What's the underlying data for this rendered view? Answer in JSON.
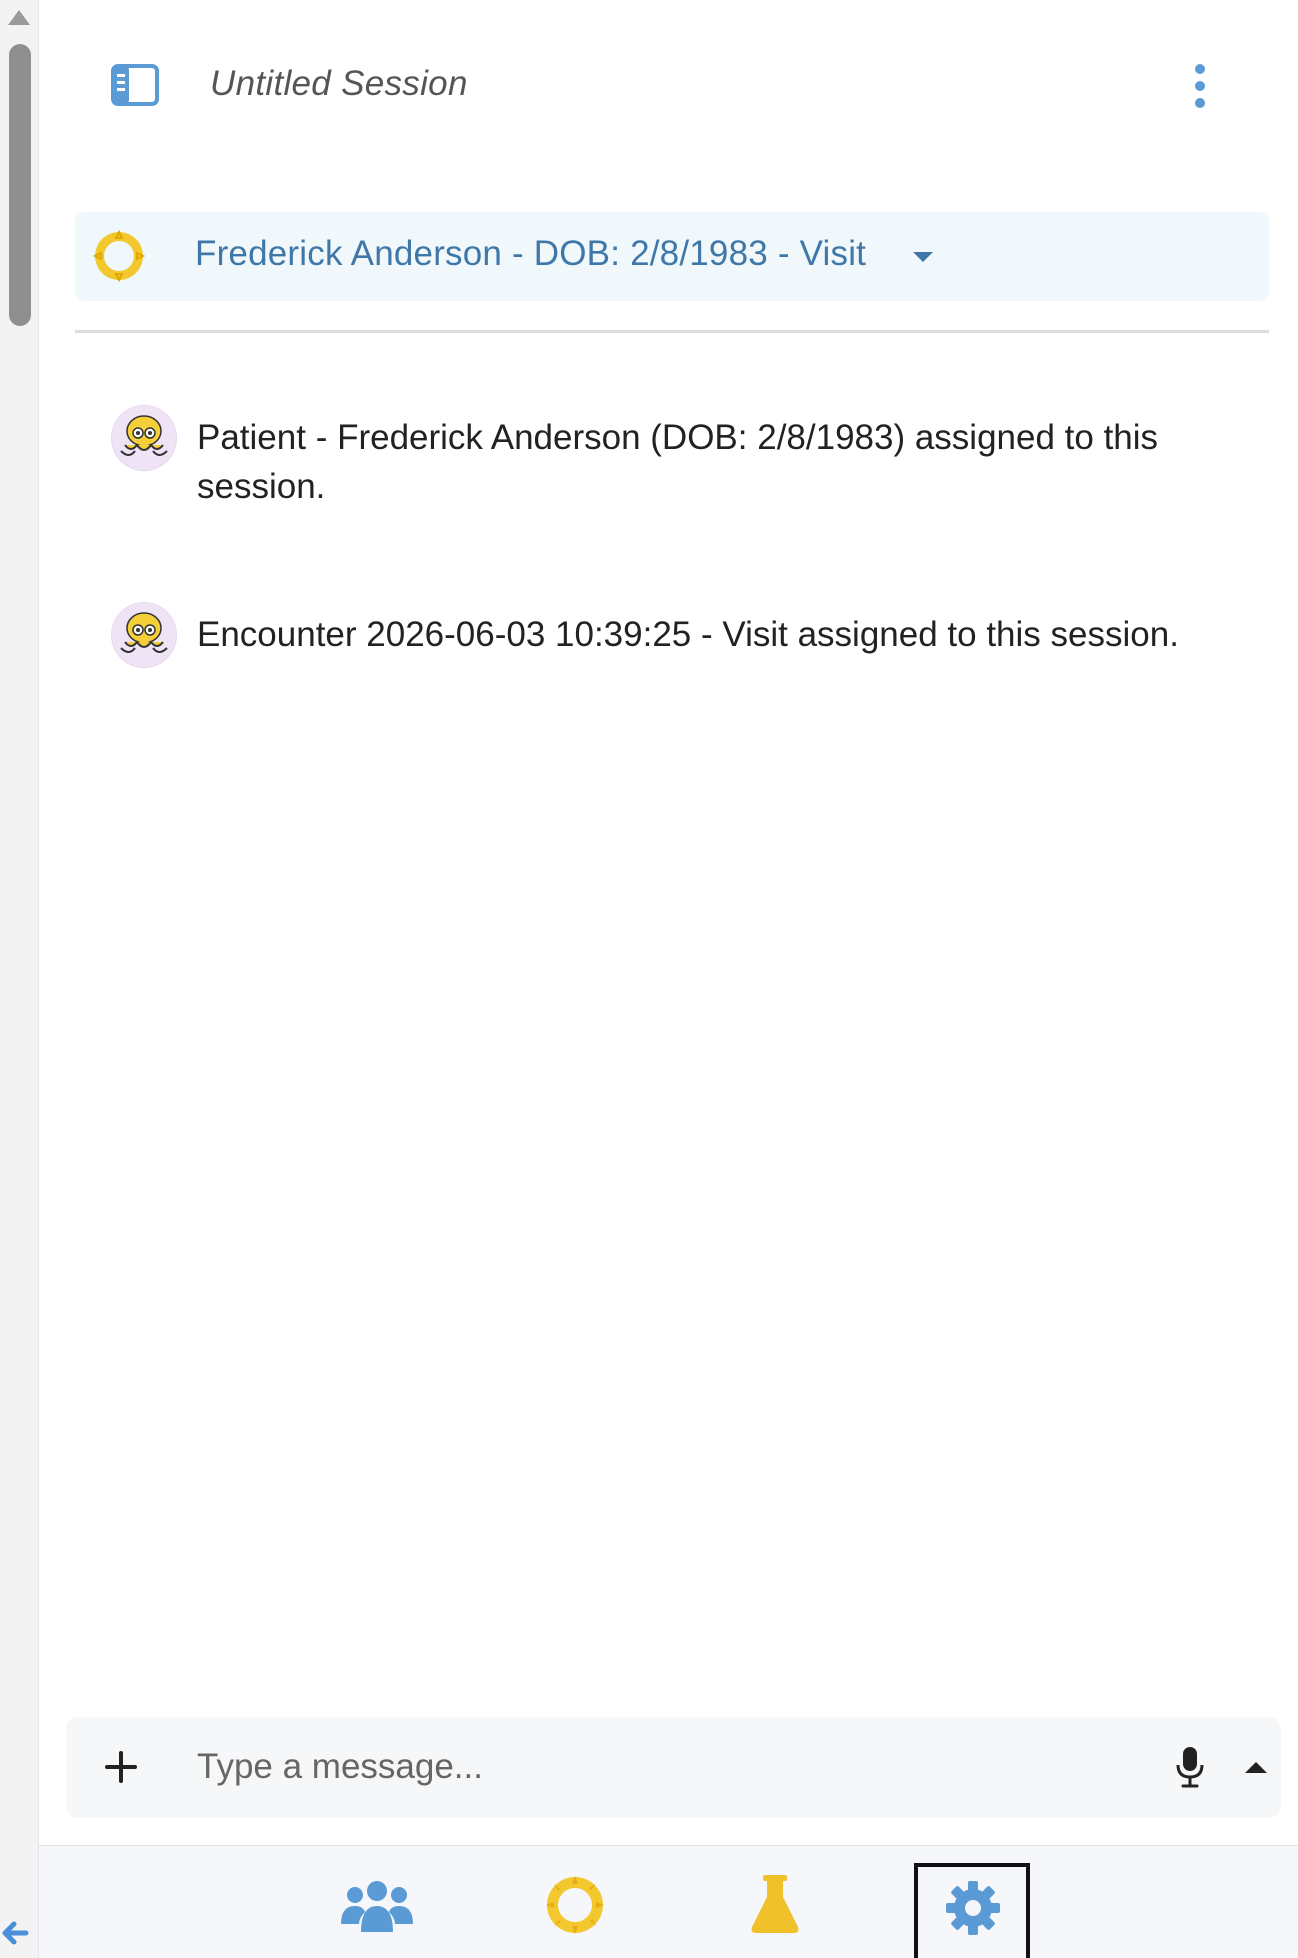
{
  "header": {
    "session_title": "Untitled Session",
    "sidebar_toggle_icon": "sidebar-panel-icon",
    "more_icon": "vertical-dots-icon"
  },
  "patient_selector": {
    "label": "Frederick Anderson - DOB: 2/8/1983 - Visit",
    "icon": "sun-ring-icon"
  },
  "messages": [
    {
      "avatar": "octopus-avatar",
      "text": "Patient - Frederick Anderson (DOB: 2/8/1983) assigned to this session."
    },
    {
      "avatar": "octopus-avatar",
      "text": "Encounter 2026-06-03 10:39:25 - Visit assigned to this session."
    }
  ],
  "composer": {
    "placeholder": "Type a message...",
    "value": "",
    "attach_icon": "plus-icon",
    "mic_icon": "microphone-icon",
    "expand_icon": "caret-up-icon"
  },
  "bottom_nav": [
    {
      "icon": "people-icon",
      "active": false
    },
    {
      "icon": "sun-ring-icon",
      "active": false
    },
    {
      "icon": "flask-icon",
      "active": false
    },
    {
      "icon": "gear-icon",
      "active": true
    }
  ],
  "colors": {
    "accent_blue": "#5b9bd5",
    "patient_text": "#3f78a8",
    "patient_bar_bg": "#f0f8fc",
    "ring_yellow": "#f2c82e",
    "flask_yellow": "#f1c12c"
  }
}
